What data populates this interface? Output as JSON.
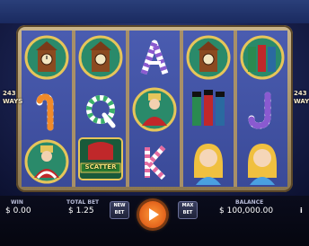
{
  "game": {
    "ways_left": "243 WAYS",
    "ways_right": "243 WAYS",
    "scatter_label": "SCATTER"
  },
  "reels": [
    [
      "cuckoo-clock",
      "candy-cane-orange",
      "king-nutcracker"
    ],
    [
      "cuckoo-clock",
      "candy-cane-green-q",
      "scatter-nutcracker"
    ],
    [
      "candy-cane-purple-a",
      "king-nutcracker",
      "candy-cane-pink-k"
    ],
    [
      "cuckoo-clock",
      "toy-soldiers",
      "clara-doll"
    ],
    [
      "toy-soldiers",
      "candy-cane-purple-j",
      "clara-doll"
    ]
  ],
  "bottom_bar": {
    "win_label": "WIN",
    "win_value": "$ 0.00",
    "total_bet_label": "TOTAL BET",
    "total_bet_value": "$ 1.25",
    "new_bet_label": "NEW BET",
    "max_bet_label": "MAX BET",
    "balance_label": "BALANCE",
    "balance_value": "$ 100,000.00",
    "info_label": "i"
  },
  "colors": {
    "accent_orange": "#e2621b",
    "frame_gold": "#c9b48a",
    "reel_blue": "#3a4a9a"
  }
}
